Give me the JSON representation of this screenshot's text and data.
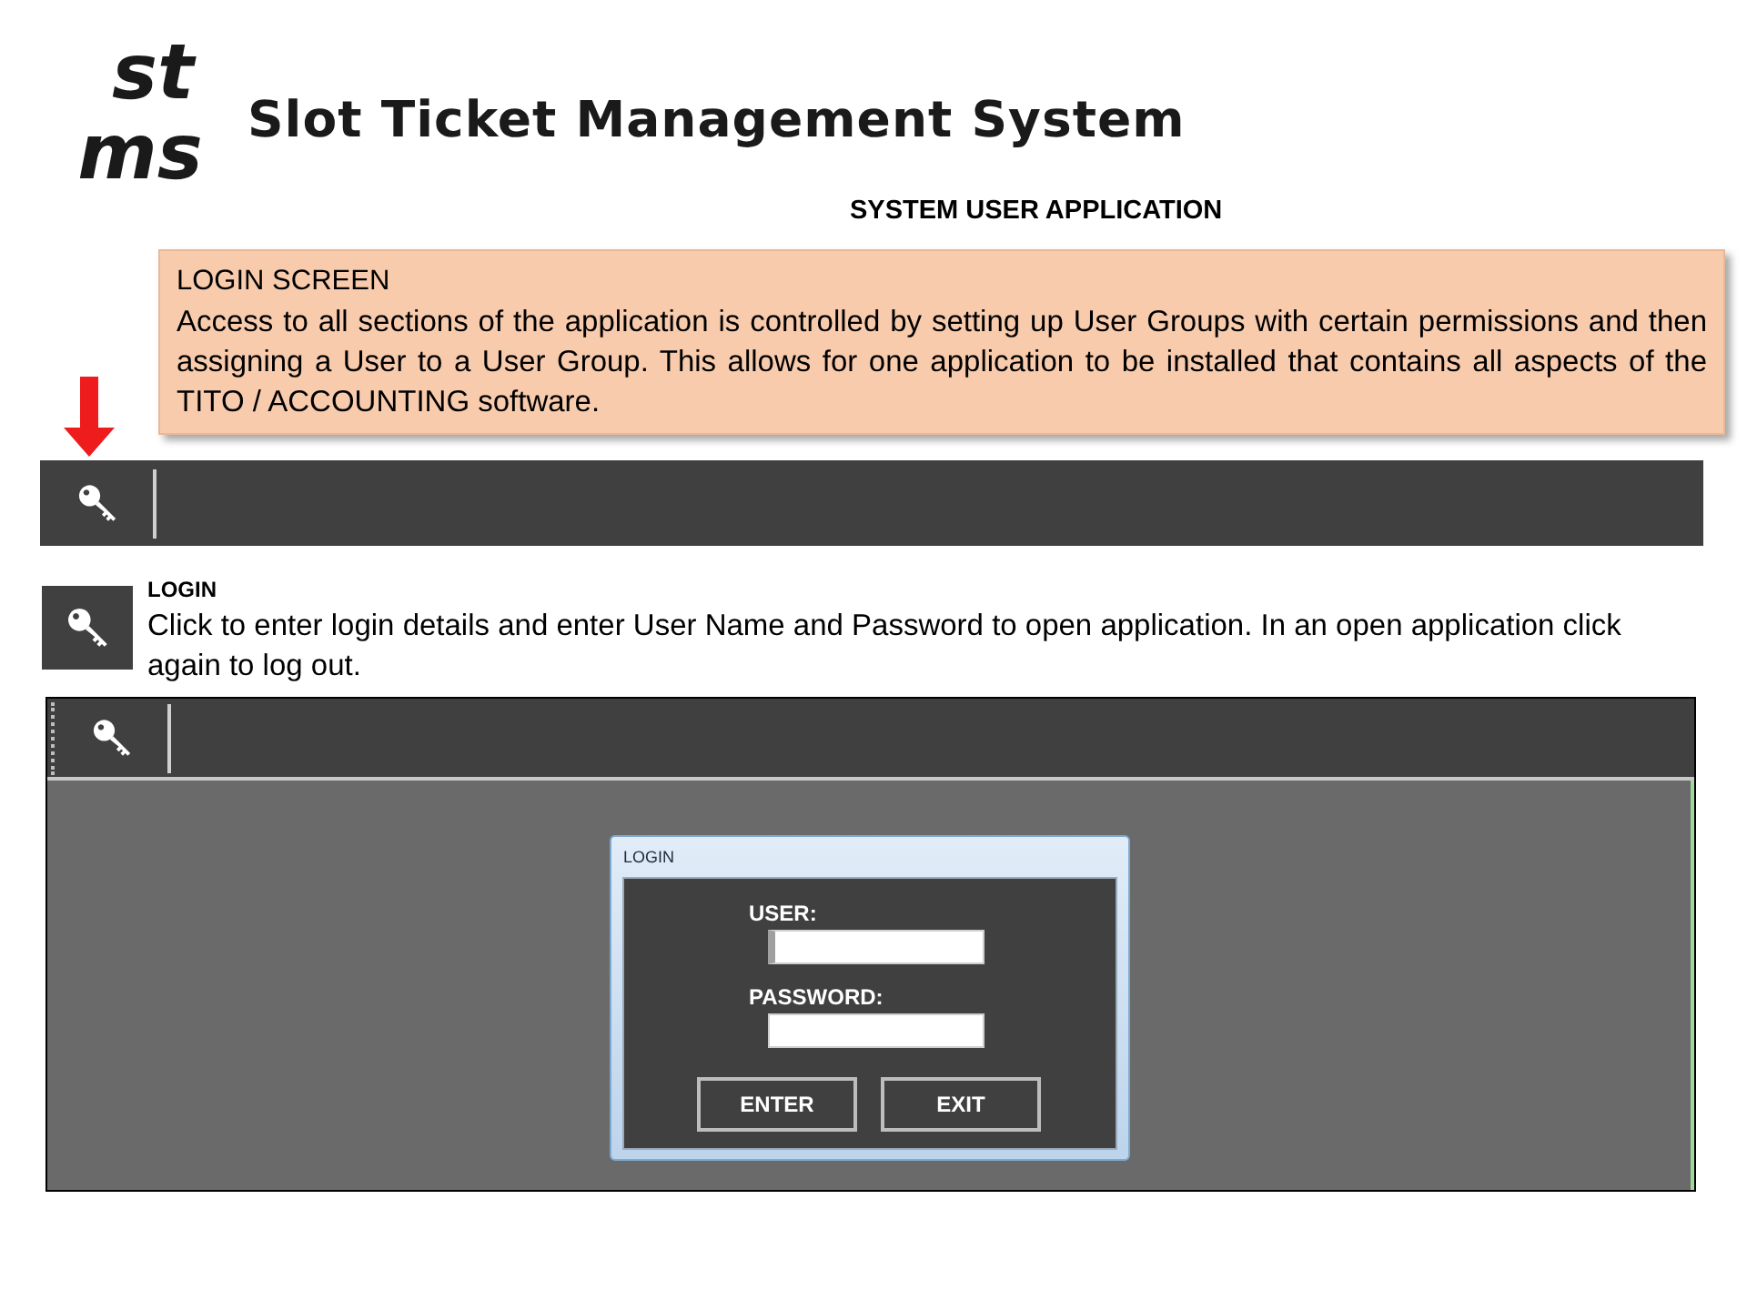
{
  "logo": {
    "monogram": [
      "st",
      "ms"
    ],
    "name": "Slot Ticket Management System"
  },
  "heading": "SYSTEM USER APPLICATION",
  "callout": {
    "title": "LOGIN SCREEN",
    "text": "Access to all sections of the application is controlled by setting up User Groups with certain permissions and then assigning a User to a User Group. This allows for one application to be installed that contains all aspects of the TITO / ACCOUNTING software."
  },
  "help": {
    "title": "LOGIN",
    "text": "Click to enter login details and enter User Name and Password to open application. In an open application click again to log out."
  },
  "app_window": {
    "dialog": {
      "title": "LOGIN",
      "fields": [
        {
          "label": "USER:",
          "focused": true
        },
        {
          "label": "PASSWORD:",
          "focused": false
        }
      ],
      "buttons": [
        "ENTER",
        "EXIT"
      ]
    }
  }
}
